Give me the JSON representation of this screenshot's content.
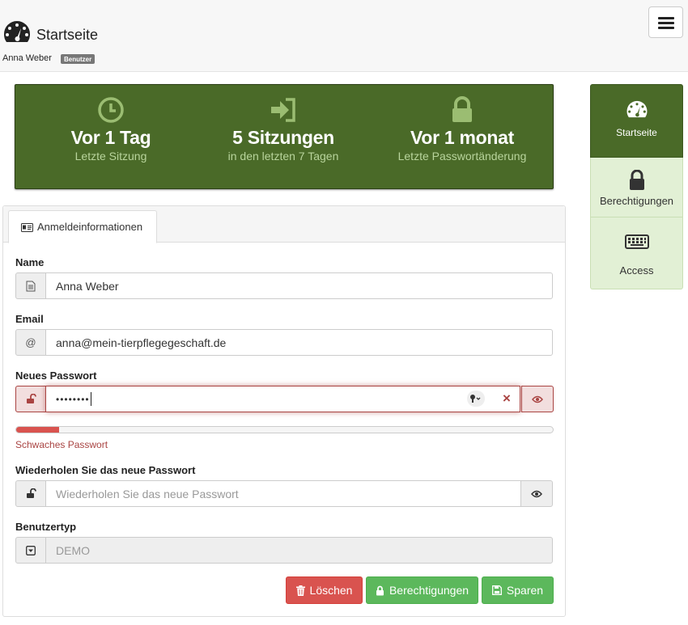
{
  "header": {
    "title": "Startseite",
    "user_name": "Anna Weber",
    "role_badge": "Benutzer",
    "brand_icon": "dashboard-gauge-icon",
    "menu_icon": "hamburger-menu-icon"
  },
  "stats": [
    {
      "icon": "clock-icon",
      "value": "Vor 1 Tag",
      "label": "Letzte Sitzung"
    },
    {
      "icon": "sign-in-icon",
      "value": "5 Sitzungen",
      "label": "in den letzten 7 Tagen"
    },
    {
      "icon": "lock-icon",
      "value": "Vor 1 monat",
      "label": "Letzte Passwortänderung"
    }
  ],
  "side_nav": {
    "items": [
      {
        "label": "Startseite",
        "icon": "dashboard-gauge-icon",
        "active": true
      },
      {
        "label": "Berechtigungen",
        "icon": "lock-icon",
        "active": false
      },
      {
        "label": "Access",
        "icon": "keyboard-icon",
        "active": false
      }
    ]
  },
  "tabs": {
    "active_label": "Anmeldeinformationen",
    "active_icon": "id-card-icon"
  },
  "form": {
    "name": {
      "label": "Name",
      "value": "Anna Weber",
      "icon": "document-icon"
    },
    "email": {
      "label": "Email",
      "value": "anna@mein-tierpflegegeschaft.de",
      "icon_text": "@"
    },
    "new_password": {
      "label": "Neues Passwort",
      "value": "••••••••",
      "icon": "unlock-icon",
      "clear_icon": "×",
      "toggle_icon": "eye-icon"
    },
    "strength": {
      "level": 0.08,
      "text": "Schwaches Passwort",
      "color": "#d9534f"
    },
    "repeat_password": {
      "label": "Wiederholen Sie das neue Passwort",
      "placeholder": "Wiederholen Sie das neue Passwort",
      "icon": "unlock-icon",
      "toggle_icon": "eye-icon"
    },
    "user_type": {
      "label": "Benutzertyp",
      "value": "DEMO",
      "icon": "caret-square-down-icon"
    }
  },
  "actions": {
    "delete_label": "Löschen",
    "permissions_label": "Berechtigungen",
    "save_label": "Sparen"
  },
  "colors": {
    "banner": "#4a6a28",
    "banner_label": "#b8d49c",
    "nav_inactive": "#e2f0d5",
    "danger": "#d9534f",
    "success": "#5cb85c"
  }
}
